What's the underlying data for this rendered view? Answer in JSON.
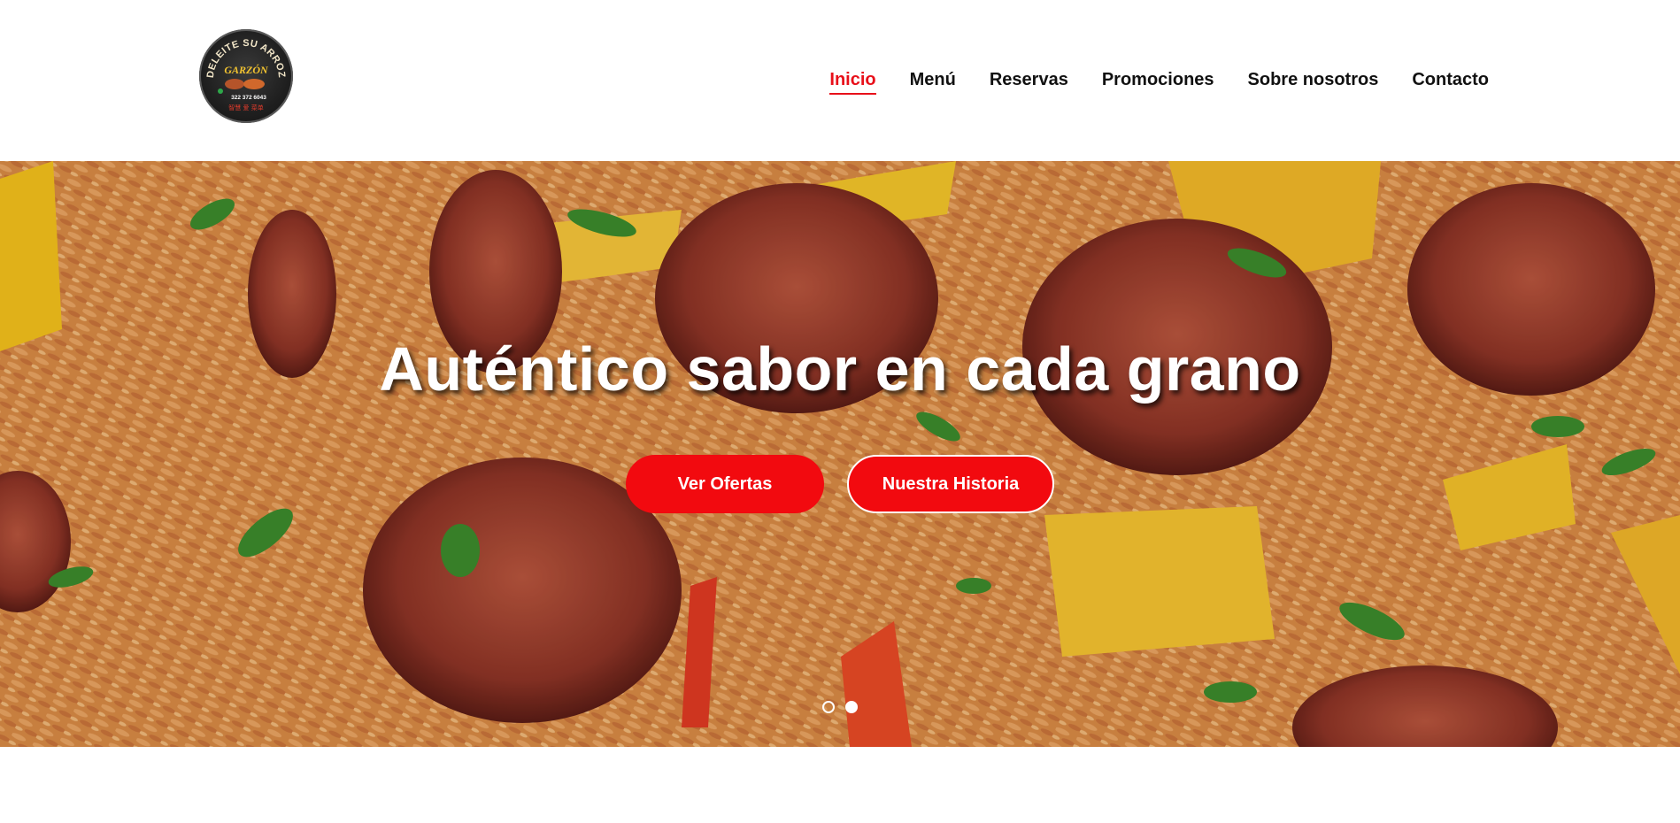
{
  "header": {
    "logo": {
      "lines": [
        "DELEITE SU ARROZ",
        "GARZÓN",
        "322 372 6043",
        "智慧 爱 菜单"
      ],
      "icon": "restaurant-logo-icon"
    },
    "nav": [
      {
        "label": "Inicio",
        "active": true
      },
      {
        "label": "Menú",
        "active": false
      },
      {
        "label": "Reservas",
        "active": false
      },
      {
        "label": "Promociones",
        "active": false
      },
      {
        "label": "Sobre nosotros",
        "active": false
      },
      {
        "label": "Contacto",
        "active": false
      }
    ]
  },
  "hero": {
    "title": "Auténtico sabor en cada grano",
    "primary_button": "Ver Ofertas",
    "secondary_button": "Nuestra Historia",
    "slides": [
      {
        "active": false
      },
      {
        "active": true
      }
    ]
  },
  "colors": {
    "accent": "#f20a0f",
    "nav_text": "#111111",
    "nav_active": "#e8101a"
  }
}
